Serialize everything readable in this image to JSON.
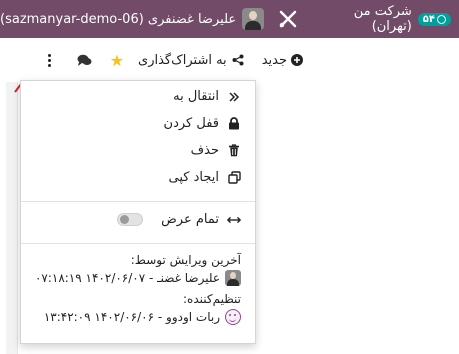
{
  "navbar": {
    "company_label": "شرکت من (تهران)",
    "activity_count": "۵۴",
    "user_label": "علیرضا غضنفری (sazmanyar-demo-06)",
    "colors": {
      "navbar_bg": "#714b67",
      "badge_bg": "#00a09d"
    }
  },
  "controlbar": {
    "new_label": "جدید",
    "share_label": "به اشتراک‌گذاری",
    "star_icon": "star-icon",
    "chat_icon": "comments-icon",
    "kebab_icon": "kebab-icon"
  },
  "dropdown": {
    "items": [
      {
        "label": "انتقال به",
        "icon": "double-chevron-icon"
      },
      {
        "label": "قفل کردن",
        "icon": "lock-icon"
      },
      {
        "label": "حذف",
        "icon": "trash-icon"
      },
      {
        "label": "ایجاد کپی",
        "icon": "copy-icon"
      }
    ],
    "fullwidth_label": "تمام عرض",
    "last_edited_label": "آخرین ویرایش توسط:",
    "last_edited_value": "علیرضا غضنـ - ۱۴۰۲/۰۶/۰۷ ۰۷:۱۸:۱۹",
    "organizer_label": "تنظیم‌کننده:",
    "organizer_value": "ربات اودوو - ۱۴۰۲/۰۶/۰۶ ۱۳:۴۲:۰۹"
  },
  "annotation": {
    "arrow_color": "#e0202a"
  }
}
